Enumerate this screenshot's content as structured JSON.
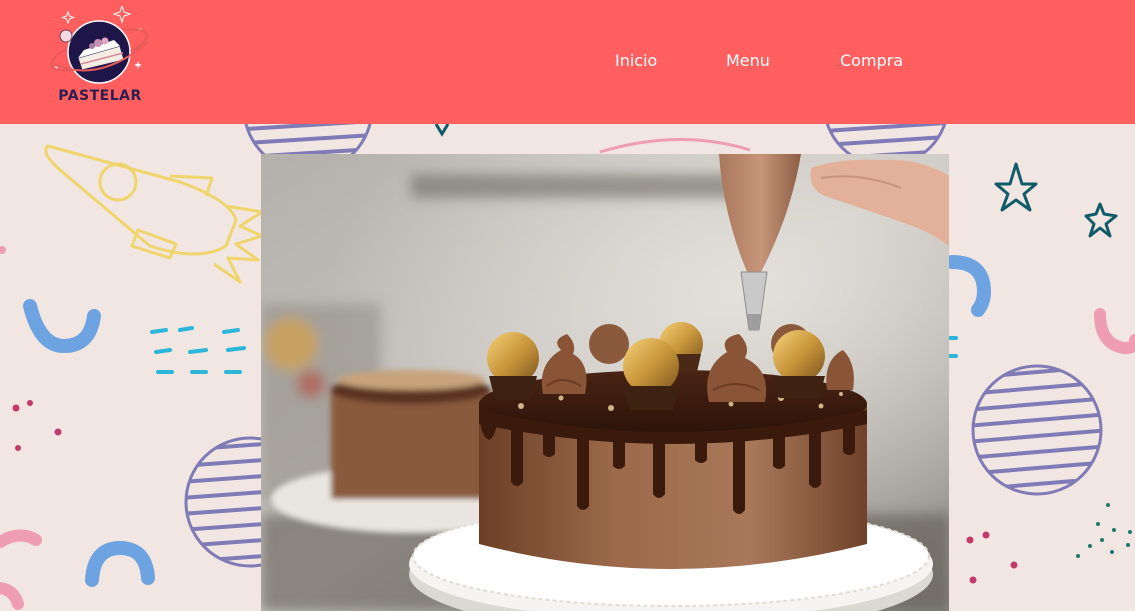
{
  "brand": {
    "name": "PASTELAR",
    "logo_icon": "cake-planet-logo"
  },
  "nav": {
    "items": [
      {
        "label": "Inicio"
      },
      {
        "label": "Menu"
      },
      {
        "label": "Compra"
      }
    ]
  },
  "hero": {
    "image": "chocolate-cake-photo"
  },
  "colors": {
    "header": "#ff5f5f",
    "background": "#f1e6e1",
    "nav_text": "#ffffff",
    "brand_text": "#2a1f4f"
  }
}
